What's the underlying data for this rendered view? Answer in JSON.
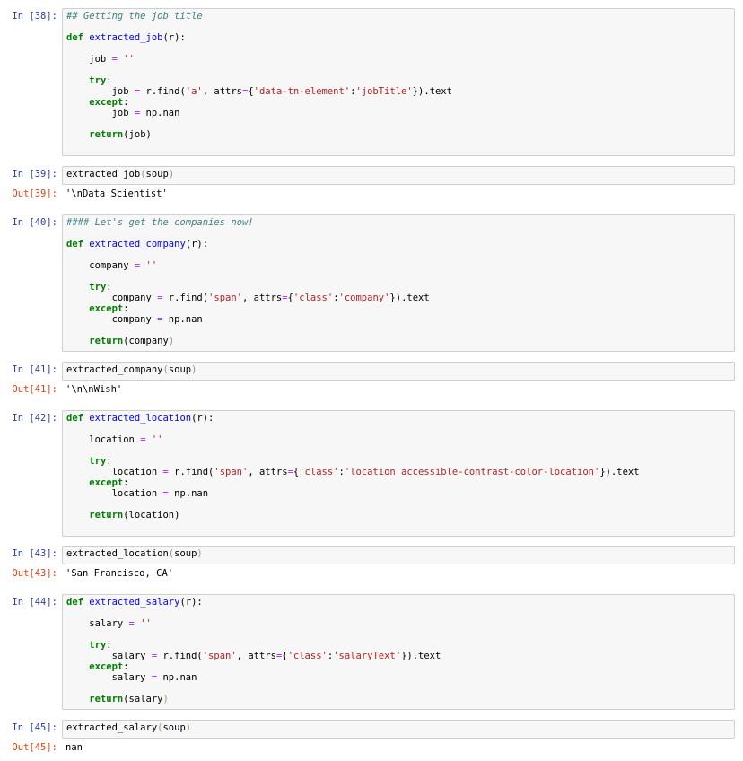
{
  "cells": [
    {
      "prompt": "In [38]:",
      "lines": [
        [
          [
            "comment",
            "## Getting the job title"
          ]
        ],
        [],
        [
          [
            "keyword",
            "def"
          ],
          [
            "plain",
            " "
          ],
          [
            "def",
            "extracted_job"
          ],
          [
            "plain",
            "(r):"
          ]
        ],
        [],
        [
          [
            "plain",
            "    job "
          ],
          [
            "op",
            "="
          ],
          [
            "plain",
            " "
          ],
          [
            "string",
            "''"
          ]
        ],
        [],
        [
          [
            "plain",
            "    "
          ],
          [
            "keyword",
            "try"
          ],
          [
            "plain",
            ":"
          ]
        ],
        [
          [
            "plain",
            "        job "
          ],
          [
            "op",
            "="
          ],
          [
            "plain",
            " r.find("
          ],
          [
            "string",
            "'a'"
          ],
          [
            "plain",
            ", attrs"
          ],
          [
            "op",
            "="
          ],
          [
            "plain",
            "{"
          ],
          [
            "string",
            "'data-tn-element'"
          ],
          [
            "plain",
            ":"
          ],
          [
            "string",
            "'jobTitle'"
          ],
          [
            "plain",
            "}).text"
          ]
        ],
        [
          [
            "plain",
            "    "
          ],
          [
            "keyword",
            "except"
          ],
          [
            "plain",
            ":"
          ]
        ],
        [
          [
            "plain",
            "        job "
          ],
          [
            "op",
            "="
          ],
          [
            "plain",
            " np.nan"
          ]
        ],
        [],
        [
          [
            "plain",
            "    "
          ],
          [
            "keyword",
            "return"
          ],
          [
            "plain",
            "(job)"
          ]
        ]
      ]
    },
    {
      "prompt": "In [39]:",
      "lines": [
        [
          [
            "plain",
            "extracted_job"
          ],
          [
            "bracket",
            "("
          ],
          [
            "plain",
            "soup"
          ],
          [
            "bracket",
            ")"
          ]
        ]
      ]
    },
    {
      "prompt": "Out[39]:",
      "output": "'\\nData Scientist'"
    },
    {
      "prompt": "In [40]:",
      "lines": [
        [
          [
            "comment",
            "#### Let's get the companies now!"
          ]
        ],
        [],
        [
          [
            "keyword",
            "def"
          ],
          [
            "plain",
            " "
          ],
          [
            "def",
            "extracted_company"
          ],
          [
            "plain",
            "(r):"
          ]
        ],
        [],
        [
          [
            "plain",
            "    company "
          ],
          [
            "op",
            "="
          ],
          [
            "plain",
            " "
          ],
          [
            "string",
            "''"
          ]
        ],
        [],
        [
          [
            "plain",
            "    "
          ],
          [
            "keyword",
            "try"
          ],
          [
            "plain",
            ":"
          ]
        ],
        [
          [
            "plain",
            "        company "
          ],
          [
            "op",
            "="
          ],
          [
            "plain",
            " r.find("
          ],
          [
            "string",
            "'span'"
          ],
          [
            "plain",
            ", attrs"
          ],
          [
            "op",
            "="
          ],
          [
            "plain",
            "{"
          ],
          [
            "string",
            "'class'"
          ],
          [
            "plain",
            ":"
          ],
          [
            "string",
            "'company'"
          ],
          [
            "plain",
            "}).text"
          ]
        ],
        [
          [
            "plain",
            "    "
          ],
          [
            "keyword",
            "except"
          ],
          [
            "plain",
            ":"
          ]
        ],
        [
          [
            "plain",
            "        company "
          ],
          [
            "op",
            "="
          ],
          [
            "plain",
            " np.nan"
          ]
        ],
        [],
        [
          [
            "plain",
            "    "
          ],
          [
            "keyword",
            "return"
          ],
          [
            "plain",
            "(company"
          ],
          [
            "bracket",
            ")"
          ]
        ]
      ]
    },
    {
      "prompt": "In [41]:",
      "lines": [
        [
          [
            "plain",
            "extracted_company"
          ],
          [
            "bracket",
            "("
          ],
          [
            "plain",
            "soup"
          ],
          [
            "bracket",
            ")"
          ]
        ]
      ]
    },
    {
      "prompt": "Out[41]:",
      "output": "'\\n\\nWish'"
    },
    {
      "prompt": "In [42]:",
      "lines": [
        [
          [
            "keyword",
            "def"
          ],
          [
            "plain",
            " "
          ],
          [
            "def",
            "extracted_location"
          ],
          [
            "plain",
            "(r):"
          ]
        ],
        [],
        [
          [
            "plain",
            "    location "
          ],
          [
            "op",
            "="
          ],
          [
            "plain",
            " "
          ],
          [
            "string",
            "''"
          ]
        ],
        [],
        [
          [
            "plain",
            "    "
          ],
          [
            "keyword",
            "try"
          ],
          [
            "plain",
            ":"
          ]
        ],
        [
          [
            "plain",
            "        location "
          ],
          [
            "op",
            "="
          ],
          [
            "plain",
            " r.find("
          ],
          [
            "string",
            "'span'"
          ],
          [
            "plain",
            ", attrs"
          ],
          [
            "op",
            "="
          ],
          [
            "plain",
            "{"
          ],
          [
            "string",
            "'class'"
          ],
          [
            "plain",
            ":"
          ],
          [
            "string",
            "'location accessible-contrast-color-location'"
          ],
          [
            "plain",
            "}).text"
          ]
        ],
        [
          [
            "plain",
            "    "
          ],
          [
            "keyword",
            "except"
          ],
          [
            "plain",
            ":"
          ]
        ],
        [
          [
            "plain",
            "        location "
          ],
          [
            "op",
            "="
          ],
          [
            "plain",
            " np.nan"
          ]
        ],
        [],
        [
          [
            "plain",
            "    "
          ],
          [
            "keyword",
            "return"
          ],
          [
            "plain",
            "(location)"
          ]
        ]
      ]
    },
    {
      "prompt": "In [43]:",
      "lines": [
        [
          [
            "plain",
            "extracted_location"
          ],
          [
            "bracket",
            "("
          ],
          [
            "plain",
            "soup"
          ],
          [
            "bracket",
            ")"
          ]
        ]
      ]
    },
    {
      "prompt": "Out[43]:",
      "output": "'San Francisco, CA'"
    },
    {
      "prompt": "In [44]:",
      "lines": [
        [
          [
            "keyword",
            "def"
          ],
          [
            "plain",
            " "
          ],
          [
            "def",
            "extracted_salary"
          ],
          [
            "plain",
            "(r):"
          ]
        ],
        [],
        [
          [
            "plain",
            "    salary "
          ],
          [
            "op",
            "="
          ],
          [
            "plain",
            " "
          ],
          [
            "string",
            "''"
          ]
        ],
        [],
        [
          [
            "plain",
            "    "
          ],
          [
            "keyword",
            "try"
          ],
          [
            "plain",
            ":"
          ]
        ],
        [
          [
            "plain",
            "        salary "
          ],
          [
            "op",
            "="
          ],
          [
            "plain",
            " r.find("
          ],
          [
            "string",
            "'span'"
          ],
          [
            "plain",
            ", attrs"
          ],
          [
            "op",
            "="
          ],
          [
            "plain",
            "{"
          ],
          [
            "string",
            "'class'"
          ],
          [
            "plain",
            ":"
          ],
          [
            "string",
            "'salaryText'"
          ],
          [
            "plain",
            "}).text"
          ]
        ],
        [
          [
            "plain",
            "    "
          ],
          [
            "keyword",
            "except"
          ],
          [
            "plain",
            ":"
          ]
        ],
        [
          [
            "plain",
            "        salary "
          ],
          [
            "op",
            "="
          ],
          [
            "plain",
            " np.nan"
          ]
        ],
        [],
        [
          [
            "plain",
            "    "
          ],
          [
            "keyword",
            "return"
          ],
          [
            "plain",
            "(salary"
          ],
          [
            "bracket",
            ")"
          ]
        ]
      ]
    },
    {
      "prompt": "In [45]:",
      "lines": [
        [
          [
            "plain",
            "extracted_salary"
          ],
          [
            "bracket",
            "("
          ],
          [
            "plain",
            "soup"
          ],
          [
            "bracket",
            ")"
          ]
        ]
      ]
    },
    {
      "prompt": "Out[45]:",
      "output": "nan"
    }
  ]
}
